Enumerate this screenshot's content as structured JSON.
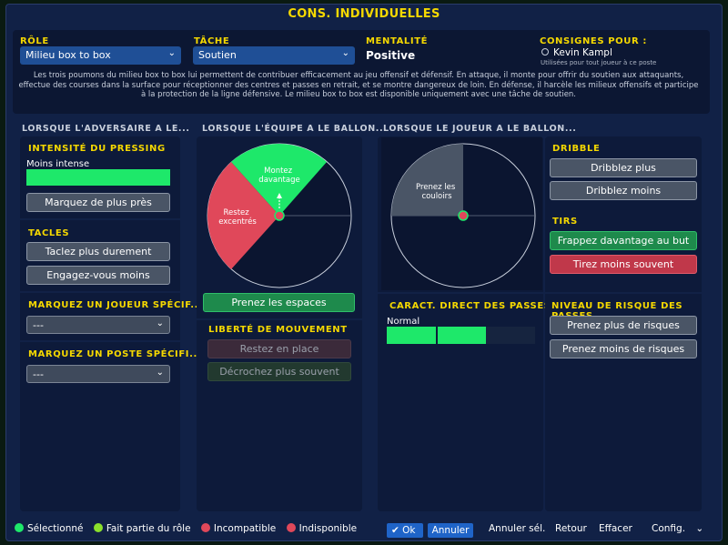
{
  "title": "CONS. INDIVIDUELLES",
  "header": {
    "role_label": "RÔLE",
    "role_value": "Milieu box to box",
    "task_label": "TÂCHE",
    "task_value": "Soutien",
    "mentality_label": "MENTALITÉ",
    "mentality_value": "Positive",
    "instructions_label": "CONSIGNES POUR :",
    "player_name": "Kevin Kampl",
    "player_note": "Utilisées pour tout joueur à ce poste"
  },
  "description": "Les trois poumons du milieu box to box lui permettent de contribuer efficacement au jeu offensif et défensif. En attaque, il monte pour offrir du soutien aux attaquants, effectue des courses dans la surface pour réceptionner des centres et passes en retrait, et se montre dangereux de loin. En défense, il harcèle les milieux offensifs et participe à la protection de la ligne défensive. Le milieu box to box est disponible uniquement avec une tâche de soutien.",
  "col1": {
    "heading": "LORSQUE L'ADVERSAIRE A LE...",
    "pressing_label": "INTENSITÉ DU PRESSING",
    "pressing_value": "Moins intense",
    "pressing_level": 1.0,
    "mark_closer": "Marquez de plus près",
    "tackles_label": "TACLES",
    "tackle_harder": "Taclez plus durement",
    "commit_less": "Engagez-vous moins",
    "mark_player_label": "MARQUEZ UN JOUEUR SPÉCIF...",
    "mark_player_value": "---",
    "mark_position_label": "MARQUEZ UN POSTE SPÉCIFI...",
    "mark_position_value": "---"
  },
  "col2": {
    "heading": "LORSQUE L'ÉQUIPE A LE BALLON...",
    "zone_forward": "Montez davantage",
    "zone_wide": "Restez excentrés",
    "take_space": "Prenez les espaces",
    "freedom_label": "LIBERTÉ DE MOUVEMENT",
    "stay_position": "Restez en place",
    "roam_more": "Décrochez plus souvent"
  },
  "col3": {
    "heading": "LORSQUE LE JOUEUR A LE BALLON...",
    "zone_channels": "Prenez les couloirs",
    "passing_label": "CARACT. DIRECT DES PASSES",
    "passing_value": "Normal",
    "passing_level": 0.67
  },
  "col4": {
    "dribble_label": "DRIBBLE",
    "dribble_more": "Dribblez plus",
    "dribble_less": "Dribblez moins",
    "shots_label": "TIRS",
    "shoot_more": "Frappez davantage au but",
    "shoot_less": "Tirez moins souvent",
    "risk_label": "NIVEAU DE RISQUE DES PASSES",
    "risk_more": "Prenez plus de risques",
    "risk_less": "Prenez moins de risques"
  },
  "legend": {
    "selected": "Sélectionné",
    "role_part": "Fait partie du rôle",
    "incompatible": "Incompatible",
    "unavailable": "Indisponible"
  },
  "footer": {
    "ok": "Ok",
    "cancel": "Annuler",
    "clear_sel": "Annuler sél.",
    "back": "Retour",
    "clear": "Effacer",
    "config": "Config."
  },
  "colors": {
    "accent_yellow": "#f5d800",
    "selected_green": "#1ee86a",
    "role_green": "#8be02c",
    "incompatible_red": "#e0485a",
    "unavailable_red": "#e0485a"
  }
}
